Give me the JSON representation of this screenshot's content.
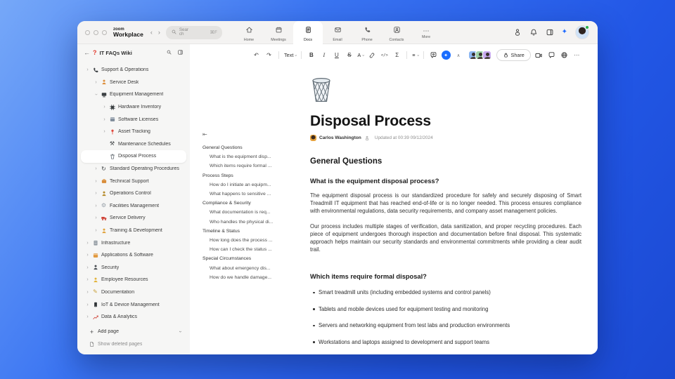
{
  "chrome": {
    "logo_top": "zoom",
    "logo_bottom": "Workplace",
    "back": "‹",
    "forward": "›",
    "search": {
      "placeholder": "Search",
      "shortcut": "⌘F"
    },
    "tabs": [
      {
        "label": "Home",
        "icon": "home",
        "active": false
      },
      {
        "label": "Meetings",
        "icon": "calendar",
        "active": false
      },
      {
        "label": "Docs",
        "icon": "doc",
        "active": true
      },
      {
        "label": "Email",
        "icon": "mail",
        "active": false
      },
      {
        "label": "Phone",
        "icon": "phone",
        "active": false
      },
      {
        "label": "Contacts",
        "icon": "contacts",
        "active": false
      },
      {
        "label": "More",
        "icon": "more",
        "active": false
      }
    ]
  },
  "sidebar": {
    "title": "IT FAQs Wiki",
    "items": [
      {
        "label": "Support & Operations",
        "level": 0,
        "chevron": "right",
        "icon": "phone",
        "color": "#3c4043",
        "selected": false
      },
      {
        "label": "Service Desk",
        "level": 1,
        "chevron": "right",
        "icon": "person",
        "color": "#dd8f3d",
        "selected": false
      },
      {
        "label": "Equipment Management",
        "level": 1,
        "chevron": "down",
        "icon": "monitor",
        "color": "#3c4043",
        "selected": false
      },
      {
        "label": "Hardware Inventory",
        "level": 2,
        "chevron": "right",
        "icon": "chip",
        "color": "#3c4043",
        "selected": false
      },
      {
        "label": "Software Licenses",
        "level": 2,
        "chevron": "right",
        "icon": "appwindow",
        "color": "#7d8a99",
        "selected": false
      },
      {
        "label": "Asset Tracking",
        "level": 2,
        "chevron": "right",
        "icon": "pin",
        "color": "#e0483d",
        "selected": false
      },
      {
        "label": "Maintenance Schedules",
        "level": 2,
        "chevron": "none",
        "icon": "tools",
        "color": "#3c4043",
        "selected": false
      },
      {
        "label": "Disposal Process",
        "level": 2,
        "chevron": "none",
        "icon": "trash",
        "color": "#6a7178",
        "selected": true
      },
      {
        "label": "Standard Operating Procedures",
        "level": 1,
        "chevron": "right",
        "icon": "refresh",
        "color": "#3c4043",
        "selected": false
      },
      {
        "label": "Technical Support",
        "level": 1,
        "chevron": "right",
        "icon": "briefcase",
        "color": "#d98d3a",
        "selected": false
      },
      {
        "label": "Operations Control",
        "level": 1,
        "chevron": "right",
        "icon": "person",
        "color": "#b58a2a",
        "selected": false
      },
      {
        "label": "Facilities Management",
        "level": 1,
        "chevron": "right",
        "icon": "gear",
        "color": "#98a1a9",
        "selected": false
      },
      {
        "label": "Service Delivery",
        "level": 1,
        "chevron": "right",
        "icon": "truck",
        "color": "#cf4237",
        "selected": false
      },
      {
        "label": "Training & Development",
        "level": 1,
        "chevron": "right",
        "icon": "person",
        "color": "#e0a23c",
        "selected": false
      },
      {
        "label": "Infrastructure",
        "level": 0,
        "chevron": "right",
        "icon": "building",
        "color": "#8a939b",
        "selected": false
      },
      {
        "label": "Applications & Software",
        "level": 0,
        "chevron": "right",
        "icon": "appwindow",
        "color": "#e0973c",
        "selected": false
      },
      {
        "label": "Security",
        "level": 0,
        "chevron": "right",
        "icon": "person",
        "color": "#4a4f54",
        "selected": false
      },
      {
        "label": "Employee Resources",
        "level": 0,
        "chevron": "right",
        "icon": "person",
        "color": "#e3b43c",
        "selected": false
      },
      {
        "label": "Documentation",
        "level": 0,
        "chevron": "right",
        "icon": "pencil",
        "color": "#c9a23c",
        "selected": false
      },
      {
        "label": "IoT & Device Management",
        "level": 0,
        "chevron": "right",
        "icon": "device",
        "color": "#2f3437",
        "selected": false
      },
      {
        "label": "Data & Analytics",
        "level": 0,
        "chevron": "right",
        "icon": "chart",
        "color": "#cf4237",
        "selected": false
      }
    ],
    "add_page": "Add page",
    "show_deleted": "Show deleted pages"
  },
  "toolbar": {
    "undo": "↶",
    "redo": "↷",
    "text_style": "Text",
    "bold": "B",
    "italic": "I",
    "underline": "U",
    "strike": "S",
    "color": "A",
    "code": "</>",
    "sigma": "Σ",
    "list": "≡",
    "collapse": "∧",
    "share": "Share",
    "ai_glyph": "✦",
    "more": "⋯"
  },
  "collaborators": [
    {
      "color": "#8db7f2"
    },
    {
      "color": "#9ed3a9"
    },
    {
      "color": "#c7a9ee"
    }
  ],
  "toc": {
    "entries": [
      {
        "label": "General Questions",
        "type": "section",
        "active": true
      },
      {
        "label": "What is the equipment disp...",
        "type": "item",
        "active": false
      },
      {
        "label": "Which items require formal ...",
        "type": "item",
        "active": false
      },
      {
        "label": "Process Steps",
        "type": "section",
        "active": false
      },
      {
        "label": "How do I initiate an equipm...",
        "type": "item",
        "active": false
      },
      {
        "label": "What happens to sensitive ...",
        "type": "item",
        "active": false
      },
      {
        "label": "Compliance & Security",
        "type": "section",
        "active": false
      },
      {
        "label": "What documentation is req...",
        "type": "item",
        "active": false
      },
      {
        "label": "Who handles the physical di...",
        "type": "item",
        "active": false
      },
      {
        "label": "Timeline & Status",
        "type": "section",
        "active": false
      },
      {
        "label": "How long does the process ...",
        "type": "item",
        "active": false
      },
      {
        "label": "How can I check the status ...",
        "type": "item",
        "active": false
      },
      {
        "label": "Special Circumstances",
        "type": "section",
        "active": false
      },
      {
        "label": "What about emergency dis...",
        "type": "item",
        "active": false
      },
      {
        "label": "How do we handle damage...",
        "type": "item",
        "active": false
      }
    ]
  },
  "doc": {
    "title": "Disposal Process",
    "author": "Carlos Washington",
    "updated": "Updated at 00:39 09/12/2024",
    "h2": "General Questions",
    "q1": {
      "heading": "What is the equipment disposal process?",
      "paragraphs": [
        "The equipment disposal process is our standardized procedure for safely and securely disposing of Smart Treadmill IT equipment that has reached end-of-life or is no longer needed. This process ensures compliance with environmental regulations, data security requirements, and company asset management policies.",
        "Our process includes multiple stages of verification, data sanitization, and proper recycling procedures. Each piece of equipment undergoes thorough inspection and documentation before final disposal. This systematic approach helps maintain our security standards and environmental commitments while providing a clear audit trail."
      ]
    },
    "q2": {
      "heading": "Which items require formal disposal?",
      "bullets": [
        "Smart treadmill units (including embedded systems and control panels)",
        "Tablets and mobile devices used for equipment testing and monitoring",
        "Servers and networking equipment from test labs and production environments",
        "Workstations and laptops assigned to development and support teams"
      ]
    }
  }
}
